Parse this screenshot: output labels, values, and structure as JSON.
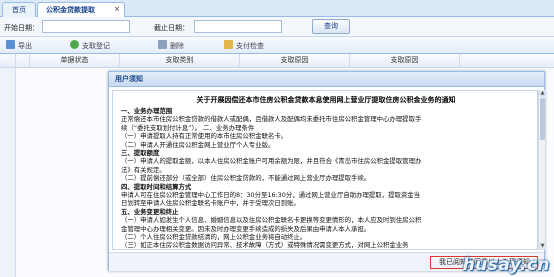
{
  "tabs": [
    {
      "label": "首页"
    },
    {
      "label": "公积金贷款提取"
    }
  ],
  "form": {
    "start_label": "开始日期：",
    "end_label": "截止日期：",
    "start_value": "",
    "end_value": "",
    "query_label": "查询"
  },
  "toolbar": {
    "export_label": "导出",
    "register_label": "支取登记",
    "delete_label": "删除",
    "check_label": "支付检查"
  },
  "grid": {
    "columns": [
      "单据状态",
      "支取类别",
      "支取原因",
      "支取原因"
    ]
  },
  "modal": {
    "title": "用户须知",
    "notice_title": "关于开展因偿还本市住房公积金贷款本息使用网上营业厅提取住房公积金业务的通知",
    "lines": [
      {
        "text": "一、业务办理范围",
        "bold": true
      },
      {
        "text": "正常偿还本市住房公积金贷款的借款人或配偶，且借款人及配偶均未委托市住房公积金管理中心办理提取手",
        "bold": false
      },
      {
        "text": "续（“委托支取划付计息”）。                        二、业务办理条件",
        "bold": false
      },
      {
        "text": "（一）申请提取人持有正常使用的本市住房公积金联名卡。",
        "bold": false
      },
      {
        "text": "（二）申请人开通住房公积金网上营业厅个人专业版。",
        "bold": false
      },
      {
        "text": "三、提取额度",
        "bold": true
      },
      {
        "text": "（一）申请人的提取金额，以本人住房公积金账户可用余额为限，并且符合《青岛市住房公积金提取管理办",
        "bold": false
      },
      {
        "text": "法》有关规定。",
        "bold": false
      },
      {
        "text": "（二）提前偿还部分（或全部）住房公积金贷款的，不能通过网上营业厅办理提取手续。",
        "bold": false
      },
      {
        "text": "四、提取时间和结算方式",
        "bold": true
      },
      {
        "text": "申请人可在住房公积金管理中心工作日的8：30分至16:30分，通过网上营业厅自助办理提取，提取资金当",
        "bold": false
      },
      {
        "text": "日划转至申请人住房公积金联名卡账户中，并于受理次日到账。",
        "bold": false
      },
      {
        "text": "五、业务变更和终止",
        "bold": true
      },
      {
        "text": "（一）申请人如发生个人信息、婚姻信息以及住房公积金联名卡更换等变更情形的，本人应及时到住房公积",
        "bold": false
      },
      {
        "text": "金管理中心办理相关变更。因未及时办理变更手续造成的损失及后果由申请人本人承担。",
        "bold": false
      },
      {
        "text": "（二）个人住房公积金贷款结清的，网上公积金业务将自动终止。",
        "bold": false
      },
      {
        "text": "（三）如正本住房公积金数据访问异常、技术故障（方式）或特殊情况需变更方式，对网上公积金业务",
        "bold": false
      }
    ],
    "ack_label": "我已阅知并同意以上办理须知"
  },
  "watermark": "husay.cn",
  "colors": {
    "accent": "#15428b",
    "border": "#99bbe8",
    "ack_border": "#d23a2e"
  }
}
